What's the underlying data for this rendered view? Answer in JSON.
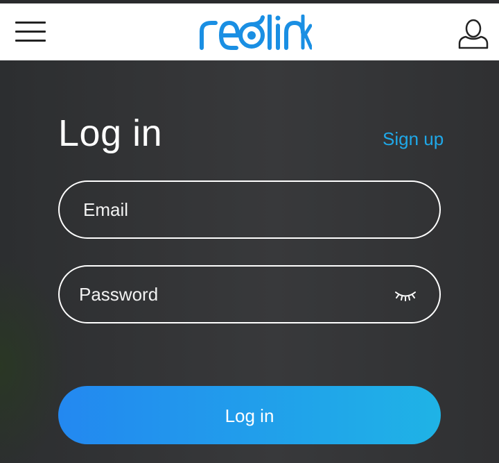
{
  "header": {
    "logo_text": "reolink",
    "menu_icon": "hamburger-menu-icon",
    "user_icon": "user-account-icon"
  },
  "login": {
    "title": "Log in",
    "signup_label": "Sign up",
    "email": {
      "placeholder": "Email",
      "value": ""
    },
    "password": {
      "placeholder": "Password",
      "value": "",
      "toggle_icon": "eye-closed-icon"
    },
    "submit_label": "Log in"
  },
  "colors": {
    "brand": "#1a8fe3",
    "link": "#1fa8e8",
    "button_start": "#2388f0",
    "button_end": "#1fb3e6",
    "background": "#2e2f31"
  }
}
